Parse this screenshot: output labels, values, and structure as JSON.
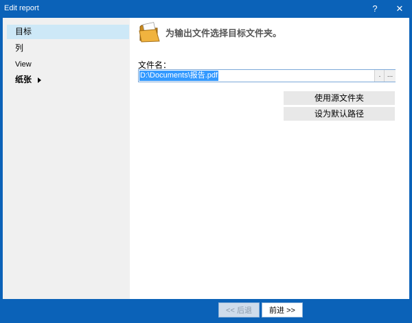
{
  "window": {
    "title": "Edit report",
    "help_label": "?",
    "close_label": "✕"
  },
  "sidebar": {
    "items": [
      {
        "label": "目标",
        "selected": true
      },
      {
        "label": "列"
      },
      {
        "label": "View"
      },
      {
        "label": "纸张",
        "has_submenu": true
      }
    ]
  },
  "main": {
    "icon": "folder-icon",
    "heading": "为输出文件选择目标文件夹。",
    "filename_label": "文件名：",
    "filename_value": "D:\\Documents\\报告.pdf",
    "field_dot_label": ".",
    "field_more_label": "...",
    "use_source_folder_label": "使用源文件夹",
    "set_default_path_label": "设为默认路径"
  },
  "footer": {
    "back_label": "<< 后退",
    "next_label": "前进 >>"
  },
  "colors": {
    "titlebar": "#0b62b8",
    "selection": "#cde8f7",
    "text_highlight": "#3399ff"
  }
}
